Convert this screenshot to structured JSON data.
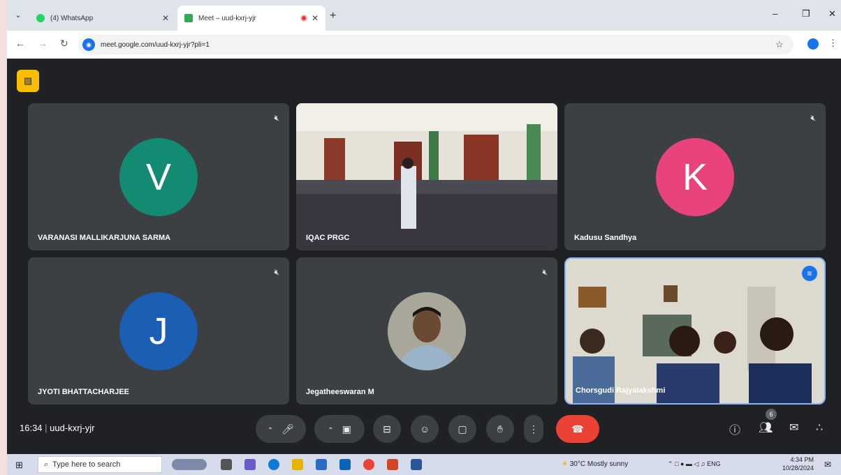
{
  "browser": {
    "tabs": [
      {
        "title": "(4) WhatsApp",
        "favicon_color": "#25d366",
        "active": false
      },
      {
        "title": "Meet – uud-kxrj-yjr",
        "favicon_color": "#34a853",
        "active": true
      }
    ],
    "url": "meet.google.com/uud-kxrj-yjr?pli=1"
  },
  "meeting": {
    "time": "16:34",
    "code": "uud-kxrj-yjr",
    "participant_count": "6",
    "tiles": [
      {
        "name": "VARANASI MALLIKARJUNA SARMA",
        "initial": "V",
        "avatar_color": "#138a72",
        "kind": "avatar",
        "muted": true
      },
      {
        "name": "IQAC PRGC",
        "kind": "video-classroom",
        "muted": false
      },
      {
        "name": "Kadusu Sandhya",
        "initial": "K",
        "avatar_color": "#e8437a",
        "kind": "avatar",
        "muted": true
      },
      {
        "name": "JYOTI BHATTACHARJEE",
        "initial": "J",
        "avatar_color": "#1a5fb4",
        "kind": "avatar",
        "muted": true
      },
      {
        "name": "Jegatheeswaran M",
        "kind": "photo",
        "muted": true
      },
      {
        "name": "Chorsgudi Rajyalakshmi",
        "kind": "video-room",
        "speaking": true
      }
    ]
  },
  "taskbar": {
    "search_placeholder": "Type here to search",
    "weather": "30°C  Mostly sunny",
    "lang": "ENG",
    "clock_time": "4:34 PM",
    "clock_date": "10/28/2024"
  },
  "colors": {
    "meet_bg": "#202124",
    "tile_bg": "#3c4043",
    "end_call": "#ea4335",
    "accent": "#8ab4f8"
  }
}
